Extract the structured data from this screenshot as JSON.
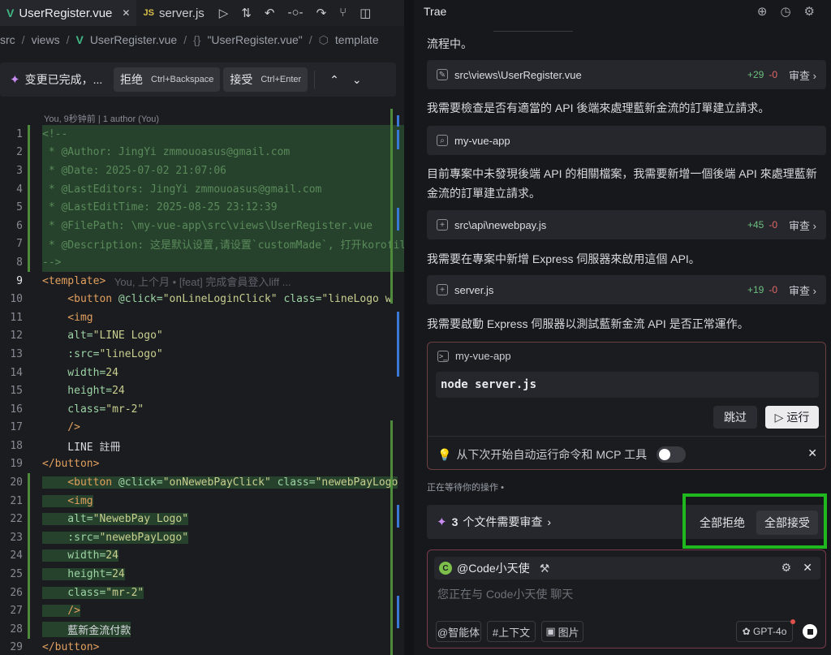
{
  "editor": {
    "tabs": [
      {
        "label": "UserRegister.vue",
        "close": "✕"
      },
      {
        "label": "server.js"
      }
    ],
    "tab_actions": [
      "run-icon",
      "compare-icon",
      "history-icon",
      "commit-icon",
      "forward-icon",
      "graph-icon",
      "split-icon"
    ],
    "breadcrumb": {
      "src": "src",
      "views": "views",
      "file": "UserRegister.vue",
      "scope": "\"UserRegister.vue\"",
      "node": "template"
    },
    "diff_bar": {
      "message": "变更已完成，...",
      "reject_label": "拒绝",
      "reject_kbd": "Ctrl+Backspace",
      "accept_label": "接受",
      "accept_kbd": "Ctrl+Enter"
    },
    "blame_header": "You, 9秒钟前 | 1 author (You)",
    "lines": [
      {
        "n": "1",
        "parts": [
          {
            "t": "<!--",
            "c": "com"
          }
        ]
      },
      {
        "n": "2",
        "parts": [
          {
            "t": " * @Author: JingYi zmmouoasus@gmail.com",
            "c": "com"
          }
        ]
      },
      {
        "n": "3",
        "parts": [
          {
            "t": " * @Date: 2025-07-02 21:07:06",
            "c": "com"
          }
        ]
      },
      {
        "n": "4",
        "parts": [
          {
            "t": " * @LastEditors: JingYi zmmouoasus@gmail.com",
            "c": "com"
          }
        ]
      },
      {
        "n": "5",
        "parts": [
          {
            "t": " * @LastEditTime: 2025-08-25 23:12:39",
            "c": "com"
          }
        ]
      },
      {
        "n": "6",
        "parts": [
          {
            "t": " * @FilePath: \\my-vue-app\\src\\views\\UserRegister.vue",
            "c": "com"
          }
        ]
      },
      {
        "n": "7",
        "parts": [
          {
            "t": " * @Description: 这是默认设置,请设置`customMade`, 打开korofileheader查看配置",
            "c": "com"
          }
        ]
      },
      {
        "n": "8",
        "parts": [
          {
            "t": "-->",
            "c": "com"
          }
        ]
      },
      {
        "n": "9",
        "parts": [
          {
            "t": "<template>",
            "c": "tag"
          },
          {
            "t": "   You, 上个月 • [feat] 完成會員登入liff ...",
            "c": "blame"
          }
        ]
      },
      {
        "n": "10",
        "parts": [
          {
            "t": "    <button ",
            "c": "tag"
          },
          {
            "t": "@click=",
            "c": "attr"
          },
          {
            "t": "\"onLineLoginClick\" ",
            "c": "str"
          },
          {
            "t": "class=",
            "c": "attr"
          },
          {
            "t": "\"lineLogo w",
            "c": "str"
          }
        ]
      },
      {
        "n": "11",
        "parts": [
          {
            "t": "    <img",
            "c": "tag"
          }
        ]
      },
      {
        "n": "12",
        "parts": [
          {
            "t": "    alt=",
            "c": "attr"
          },
          {
            "t": "\"LINE Logo\"",
            "c": "str"
          }
        ]
      },
      {
        "n": "13",
        "parts": [
          {
            "t": "    :src=",
            "c": "attr"
          },
          {
            "t": "\"lineLogo\"",
            "c": "str"
          }
        ]
      },
      {
        "n": "14",
        "parts": [
          {
            "t": "    width=",
            "c": "attr"
          },
          {
            "t": "24",
            "c": "str"
          }
        ]
      },
      {
        "n": "15",
        "parts": [
          {
            "t": "    height=",
            "c": "attr"
          },
          {
            "t": "24",
            "c": "str"
          }
        ]
      },
      {
        "n": "16",
        "parts": [
          {
            "t": "    class=",
            "c": "attr"
          },
          {
            "t": "\"mr-2\"",
            "c": "str"
          }
        ]
      },
      {
        "n": "17",
        "parts": [
          {
            "t": "    />",
            "c": "tag"
          }
        ]
      },
      {
        "n": "18",
        "parts": [
          {
            "t": "    LINE 註冊",
            "c": "txt"
          }
        ]
      },
      {
        "n": "19",
        "parts": [
          {
            "t": "</button>",
            "c": "tag"
          }
        ]
      },
      {
        "n": "20",
        "parts": [
          {
            "t": "    <button ",
            "c": "tag"
          },
          {
            "t": "@click=",
            "c": "attr"
          },
          {
            "t": "\"onNewebPayClick\" ",
            "c": "str"
          },
          {
            "t": "class=",
            "c": "attr"
          },
          {
            "t": "\"newebPayLogo",
            "c": "str"
          }
        ]
      },
      {
        "n": "21",
        "parts": [
          {
            "t": "    <img",
            "c": "tag"
          }
        ]
      },
      {
        "n": "22",
        "parts": [
          {
            "t": "    alt=",
            "c": "attr"
          },
          {
            "t": "\"NewebPay Logo\"",
            "c": "str"
          }
        ]
      },
      {
        "n": "23",
        "parts": [
          {
            "t": "    :src=",
            "c": "attr"
          },
          {
            "t": "\"newebPayLogo\"",
            "c": "str"
          }
        ]
      },
      {
        "n": "24",
        "parts": [
          {
            "t": "    width=",
            "c": "attr"
          },
          {
            "t": "24",
            "c": "str"
          }
        ]
      },
      {
        "n": "25",
        "parts": [
          {
            "t": "    height=",
            "c": "attr"
          },
          {
            "t": "24",
            "c": "str"
          }
        ]
      },
      {
        "n": "26",
        "parts": [
          {
            "t": "    class=",
            "c": "attr"
          },
          {
            "t": "\"mr-2\"",
            "c": "str"
          }
        ]
      },
      {
        "n": "27",
        "parts": [
          {
            "t": "    />",
            "c": "tag"
          }
        ]
      },
      {
        "n": "28",
        "parts": [
          {
            "t": "    藍新金流付款",
            "c": "txt"
          }
        ]
      },
      {
        "n": "29",
        "parts": [
          {
            "t": "</button>",
            "c": "tag"
          }
        ]
      }
    ]
  },
  "chat": {
    "title": "Trae",
    "head_icons": [
      "new-chat-icon",
      "history-icon",
      "settings-icon"
    ],
    "msg_top": "流程中。",
    "file1": {
      "name": "src\\views\\UserRegister.vue",
      "plus": "+29",
      "minus": "-0",
      "view": "审查"
    },
    "msg1": "我需要檢查是否有適當的 API 後端來處理藍新金流的訂單建立請求。",
    "search": {
      "name": "my-vue-app"
    },
    "msg2": "目前專案中未發現後端 API 的相關檔案，我需要新增一個後端 API 來處理藍新金流的訂單建立請求。",
    "file2": {
      "name": "src\\api\\newebpay.js",
      "plus": "+45",
      "minus": "-0",
      "view": "审查"
    },
    "msg3": "我需要在專案中新增 Express 伺服器來啟用這個 API。",
    "file3": {
      "name": "server.js",
      "plus": "+19",
      "minus": "-0",
      "view": "审查"
    },
    "msg4": "我需要啟動 Express 伺服器以測試藍新金流 API 是否正常運作。",
    "terminal": {
      "cwd": "my-vue-app",
      "command": "node server.js",
      "skip_label": "跳过",
      "run_label": "运行",
      "auto_text": "从下次开始自动运行命令和 MCP 工具"
    },
    "waiting": "正在等待你的操作",
    "review": {
      "count": "3",
      "text": "个文件需要审查",
      "reject_all": "全部拒绝",
      "accept_all": "全部接受"
    },
    "input": {
      "agent": "@Code小天使",
      "placeholder": "您正在与 Code小天使 聊天",
      "chips": [
        "@智能体",
        "#上下文",
        "图片"
      ],
      "model": "GPT-4o"
    }
  }
}
